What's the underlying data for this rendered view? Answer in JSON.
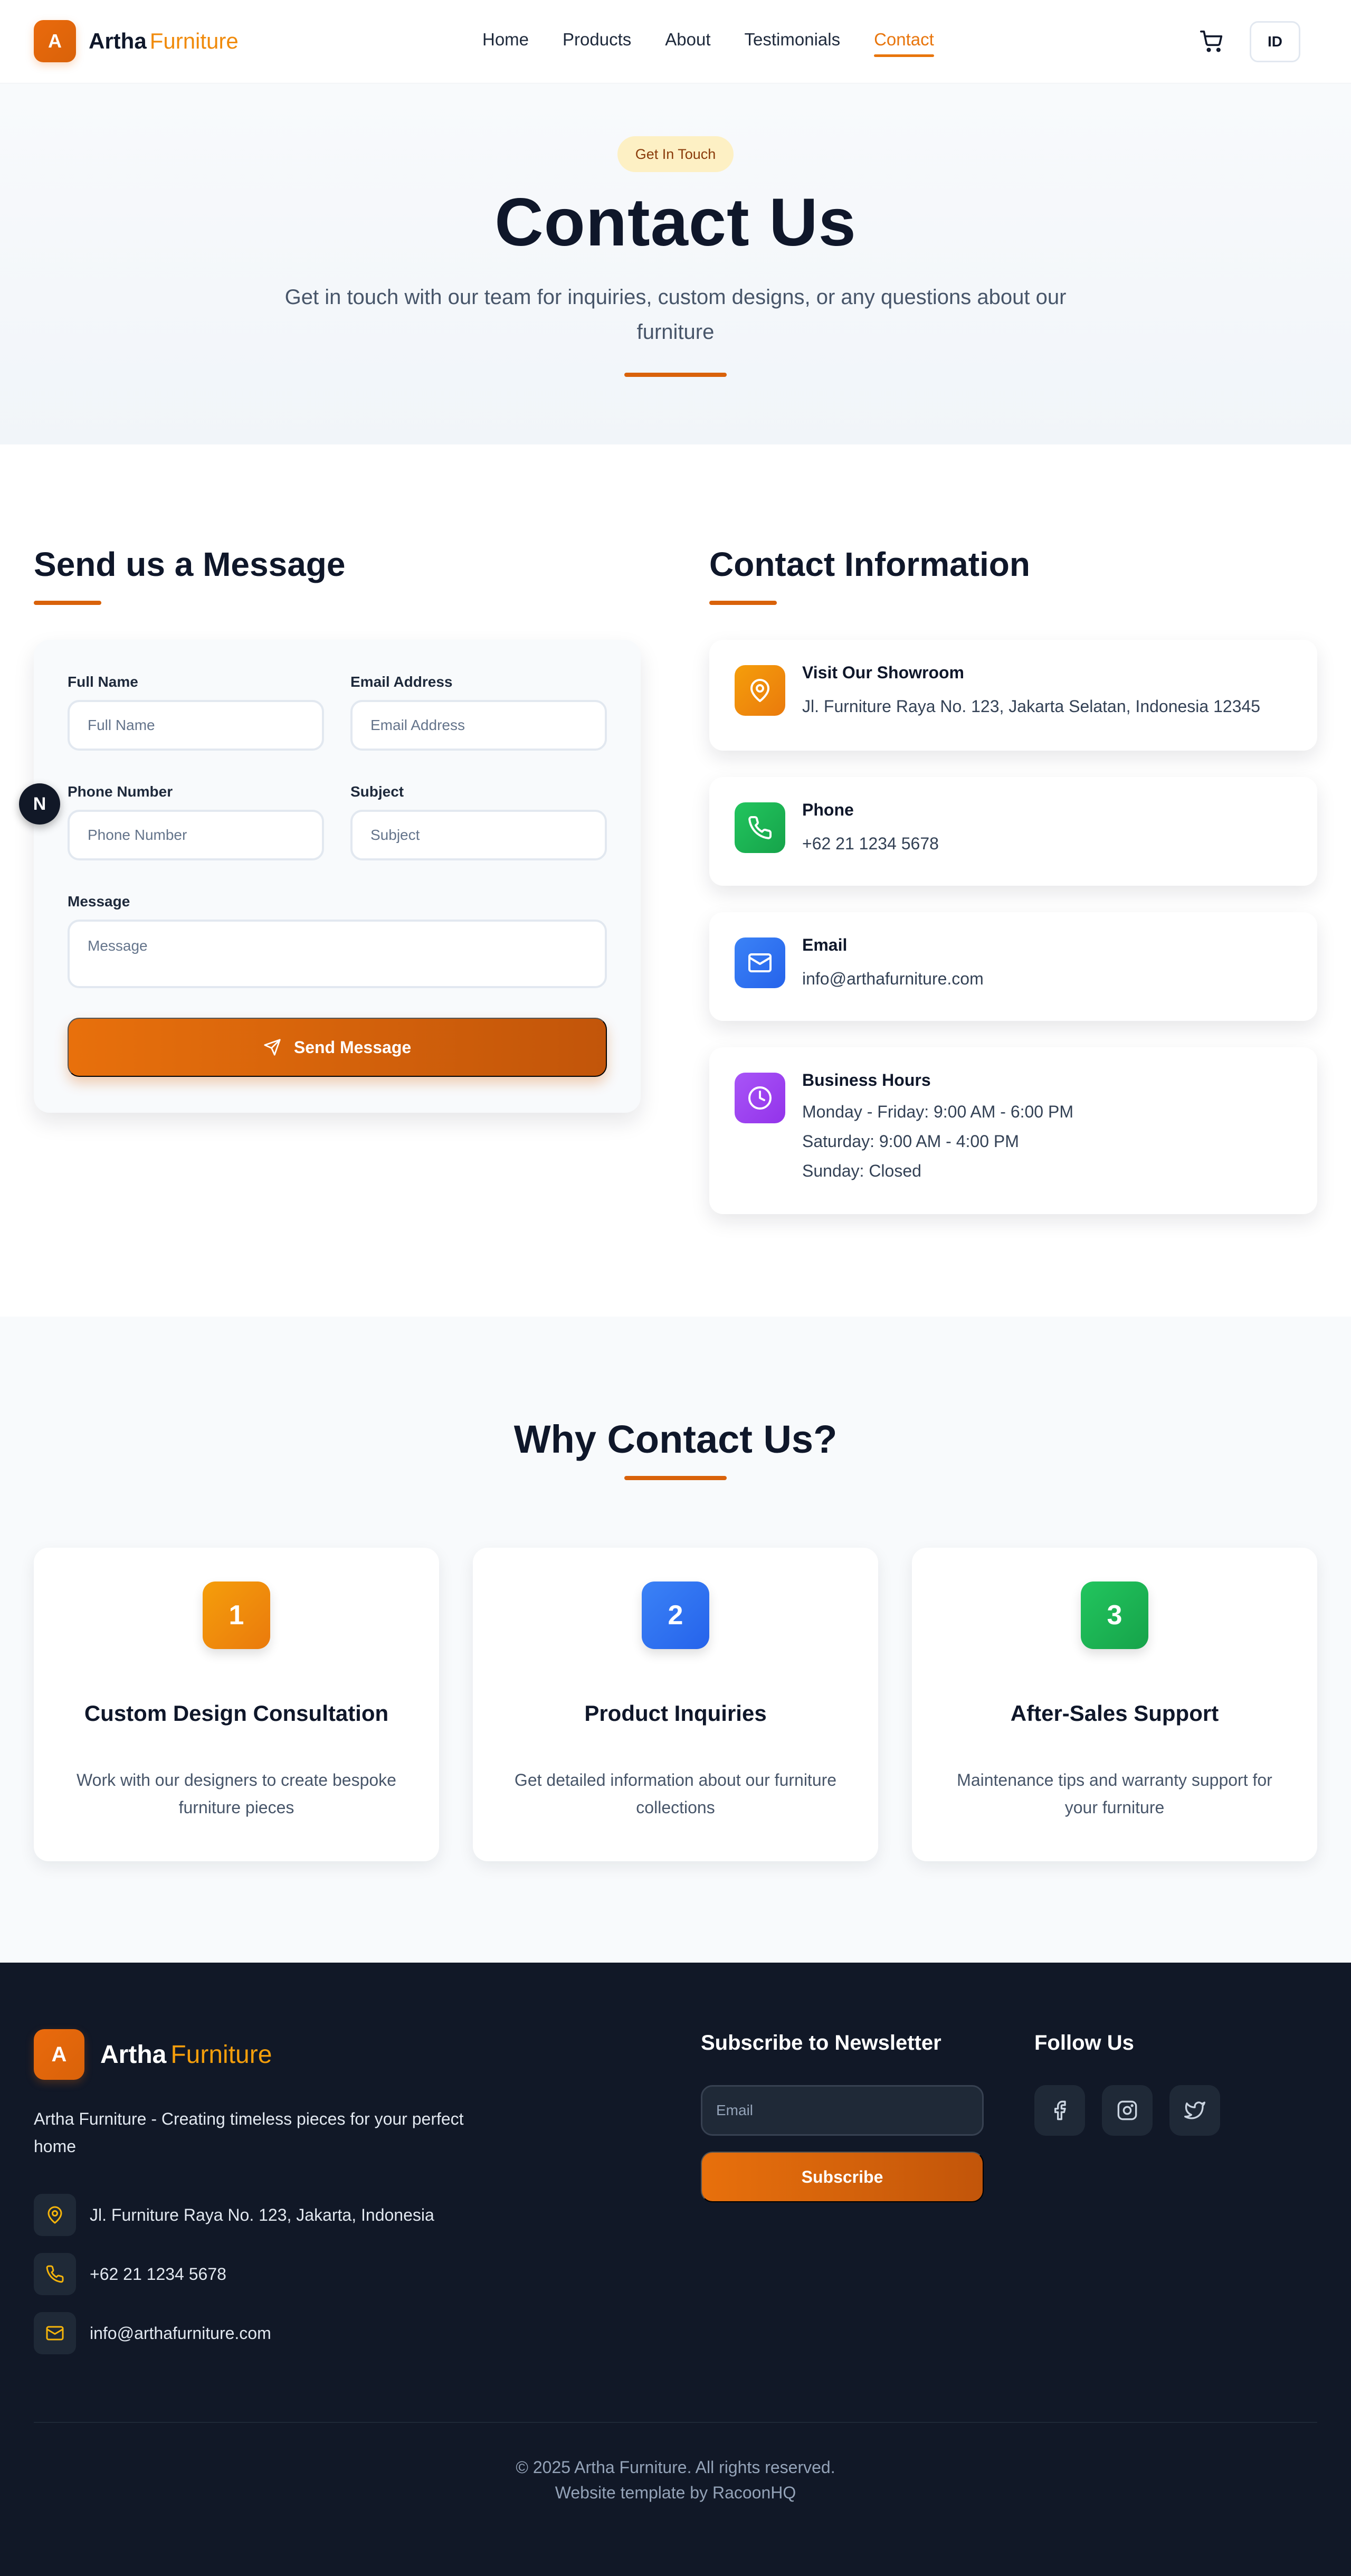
{
  "header": {
    "logo_letter": "A",
    "logo_name": "Artha",
    "logo_accent": "Furniture",
    "nav": [
      {
        "label": "Home",
        "active": false
      },
      {
        "label": "Products",
        "active": false
      },
      {
        "label": "About",
        "active": false
      },
      {
        "label": "Testimonials",
        "active": false
      },
      {
        "label": "Contact",
        "active": true
      }
    ],
    "cart_icon": "cart-icon",
    "language_label": "ID"
  },
  "hero": {
    "badge": "Get In Touch",
    "title": "Contact Us",
    "subtitle": "Get in touch with our team for inquiries, custom designs, or any questions about our furniture"
  },
  "form": {
    "title": "Send us a Message",
    "full_name_label": "Full Name",
    "full_name_placeholder": "Full Name",
    "email_label": "Email Address",
    "email_placeholder": "Email Address",
    "phone_label": "Phone Number",
    "phone_placeholder": "Phone Number",
    "subject_label": "Subject",
    "subject_placeholder": "Subject",
    "message_label": "Message",
    "message_placeholder": "Message",
    "submit_label": "Send Message"
  },
  "contact_info": {
    "title": "Contact Information",
    "showroom_title": "Visit Our Showroom",
    "showroom_address": "Jl. Furniture Raya No. 123, Jakarta Selatan, Indonesia 12345",
    "phone_title": "Phone",
    "phone_value": "+62 21 1234 5678",
    "email_title": "Email",
    "email_value": "info@arthafurniture.com",
    "hours_title": "Business Hours",
    "hours": [
      "Monday - Friday: 9:00 AM - 6:00 PM",
      "Saturday: 9:00 AM - 4:00 PM",
      "Sunday: Closed"
    ],
    "colors": {
      "showroom": "#f59e0b",
      "phone": "#22c55e",
      "email": "#3b82f6",
      "hours": "#a855f7"
    }
  },
  "floating_badge": "N",
  "why": {
    "title": "Why Contact Us?",
    "cards": [
      {
        "number": "1",
        "title": "Custom Design Consultation",
        "desc": "Work with our designers to create bespoke furniture pieces",
        "color": "#f59e0b"
      },
      {
        "number": "2",
        "title": "Product Inquiries",
        "desc": "Get detailed information about our furniture collections",
        "color": "#3b82f6"
      },
      {
        "number": "3",
        "title": "After-Sales Support",
        "desc": "Maintenance tips and warranty support for your furniture",
        "color": "#22c55e"
      }
    ]
  },
  "footer": {
    "logo_letter": "A",
    "logo_name": "Artha",
    "logo_accent": "Furniture",
    "tagline": "Artha Furniture - Creating timeless pieces for your perfect home",
    "address": "Jl. Furniture Raya No. 123, Jakarta, Indonesia",
    "phone": "+62 21 1234 5678",
    "email": "info@arthafurniture.com",
    "newsletter_title": "Subscribe to Newsletter",
    "newsletter_placeholder": "Email",
    "subscribe_label": "Subscribe",
    "follow_title": "Follow Us",
    "social_icons": [
      "facebook-icon",
      "instagram-icon",
      "twitter-icon"
    ],
    "copyright": "© 2025 Artha Furniture. All rights reserved.",
    "credit": "Website template by RacoonHQ"
  },
  "colors": {
    "brand_orange": "#d9620a",
    "accent_orange": "#e8750c",
    "footer_bg": "#111827"
  }
}
